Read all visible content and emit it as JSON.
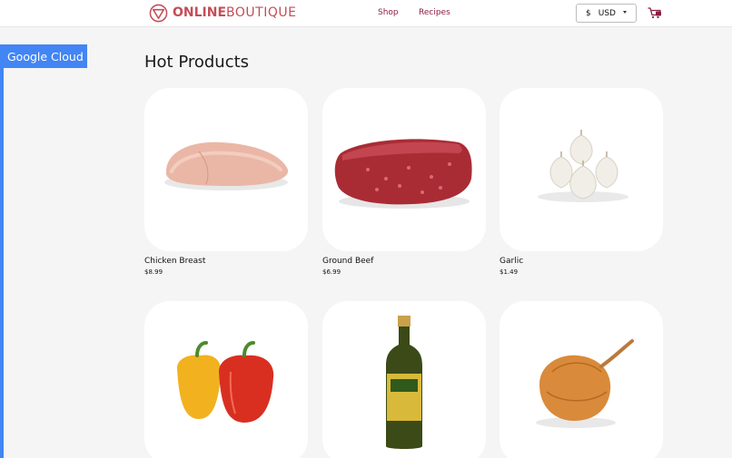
{
  "header": {
    "logo_bold": "ONLINE",
    "logo_light": "BOUTIQUE",
    "nav": [
      "Shop",
      "Recipes"
    ],
    "currency": {
      "symbol": "$",
      "code": "USD"
    },
    "cart_icon": "cart-icon"
  },
  "banner": {
    "label": "Google Cloud"
  },
  "main": {
    "title": "Hot Products",
    "products": [
      {
        "name": "Chicken Breast",
        "price": "$8.99",
        "image": "chicken-breast-image"
      },
      {
        "name": "Ground Beef",
        "price": "$6.99",
        "image": "ground-beef-image"
      },
      {
        "name": "Garlic",
        "price": "$1.49",
        "image": "garlic-image"
      },
      {
        "name": "",
        "price": "",
        "image": "bell-peppers-image"
      },
      {
        "name": "",
        "price": "",
        "image": "olive-oil-image"
      },
      {
        "name": "",
        "price": "",
        "image": "onion-image"
      }
    ]
  },
  "colors": {
    "brand": "#c44d57",
    "nav": "#8b1e3f",
    "google_blue": "#4285f4"
  }
}
